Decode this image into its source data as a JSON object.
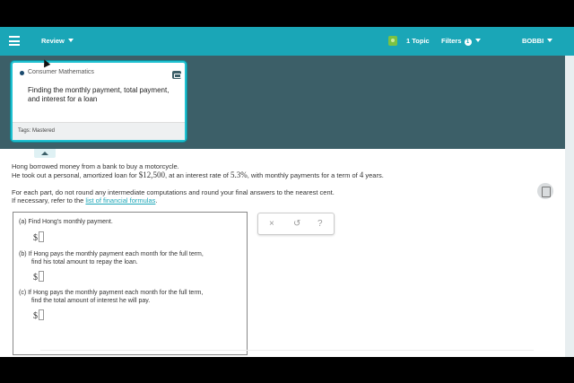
{
  "topbar": {
    "menu_icon": "hamburger-icon",
    "review_label": "Review",
    "topic_icon": "topic-icon",
    "topic_label": "1 Topic",
    "filters_label": "Filters",
    "filters_count": "1",
    "user_label": "BOBBI"
  },
  "topic_card": {
    "category": "Consumer Mathematics",
    "title": "Finding the monthly payment, total payment, and interest for a loan",
    "tags": "Tags: Mastered"
  },
  "problem": {
    "line1": "Hong borrowed money from a bank to buy a motorcycle.",
    "line2_prefix": "He took out a personal, amortized loan for",
    "loan_amount": "$12,500",
    "line2_mid": ", at an interest rate of",
    "interest_rate": "5.3%",
    "line2_mid2": ", with monthly payments for a term of",
    "term": "4",
    "line2_suffix": "years.",
    "line3": "For each part, do not round any intermediate computations and round your final answers to the nearest cent.",
    "line4_prefix": "If necessary, refer to the",
    "formulas_link": "list of financial formulas",
    "line4_suffix": "."
  },
  "parts": {
    "a_line1": "(a)  Find Hong's monthly payment.",
    "b_line1": "(b)  If Hong pays the monthly payment each month for the full term,",
    "b_line2": "find his total amount to repay the loan.",
    "c_line1": "(c)  If Hong pays the monthly payment each month for the full term,",
    "c_line2": "find the total amount of interest he will pay.",
    "currency": "$"
  },
  "tools": {
    "clear": "×",
    "undo": "↺",
    "help": "?"
  }
}
